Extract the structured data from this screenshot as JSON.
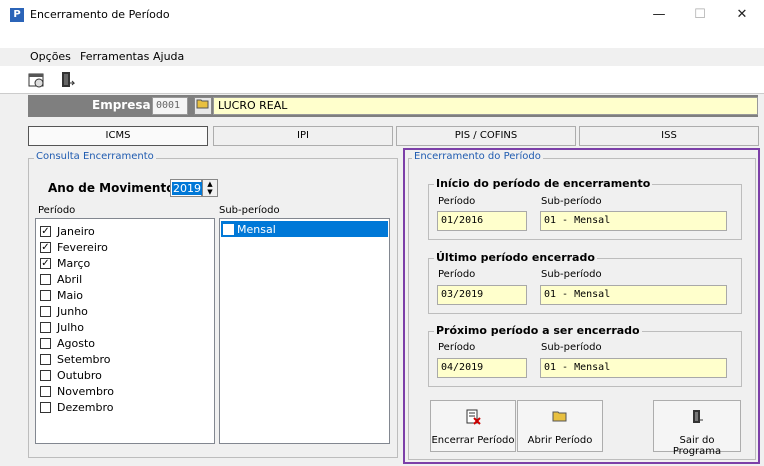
{
  "window": {
    "icon_letter": "P",
    "title": "Encerramento de Período",
    "minimize": "—",
    "maximize": "☐",
    "close": "✕"
  },
  "menu": [
    "Opções",
    "Ferramentas",
    "Ajuda"
  ],
  "empresa": {
    "label": "Empresa",
    "code": "0001",
    "name": "LUCRO REAL"
  },
  "tabs": [
    "ICMS",
    "IPI",
    "PIS / COFINS",
    "ISS"
  ],
  "consulta": {
    "legend": "Consulta Encerramento",
    "ano_label": "Ano de Movimento",
    "ano_value": "2019",
    "periodo_header": "Período",
    "subperiodo_header": "Sub-período",
    "meses": [
      {
        "label": "Janeiro",
        "checked": true
      },
      {
        "label": "Fevereiro",
        "checked": true
      },
      {
        "label": "Março",
        "checked": true
      },
      {
        "label": "Abril",
        "checked": false
      },
      {
        "label": "Maio",
        "checked": false
      },
      {
        "label": "Junho",
        "checked": false
      },
      {
        "label": "Julho",
        "checked": false
      },
      {
        "label": "Agosto",
        "checked": false
      },
      {
        "label": "Setembro",
        "checked": false
      },
      {
        "label": "Outubro",
        "checked": false
      },
      {
        "label": "Novembro",
        "checked": false
      },
      {
        "label": "Dezembro",
        "checked": false
      }
    ],
    "subperiodos": [
      "Mensal"
    ]
  },
  "encerramento": {
    "legend": "Encerramento do Período",
    "inicio": {
      "title": "Início do período de encerramento",
      "periodo_label": "Período",
      "sub_label": "Sub-período",
      "periodo": "01/2016",
      "sub": "01 - Mensal"
    },
    "ultimo": {
      "title": "Último período encerrado",
      "periodo_label": "Período",
      "sub_label": "Sub-período",
      "periodo": "03/2019",
      "sub": "01 - Mensal"
    },
    "proximo": {
      "title": "Próximo período a ser encerrado",
      "periodo_label": "Período",
      "sub_label": "Sub-período",
      "periodo": "04/2019",
      "sub": "01 - Mensal"
    }
  },
  "buttons": {
    "encerrar": "Encerrar Período",
    "abrir": "Abrir Período",
    "sair": "Sair do Programa"
  },
  "colors": {
    "highlight": "#7c3fa8",
    "selection": "#0078d7",
    "field_bg": "#ffffcc"
  }
}
